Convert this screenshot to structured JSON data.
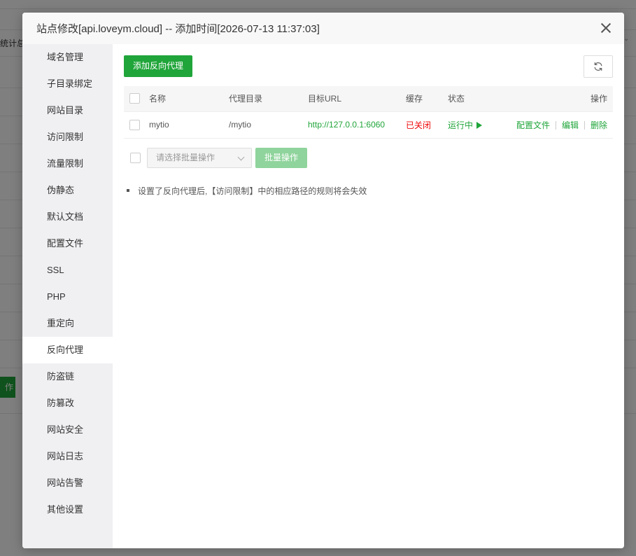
{
  "background": {
    "left_text": "统计总",
    "button_label": "作"
  },
  "modal": {
    "title": "站点修改[api.loveym.cloud] -- 添加时间[2026-07-13 11:37:03]"
  },
  "sidebar": {
    "items": [
      {
        "label": "域名管理"
      },
      {
        "label": "子目录绑定"
      },
      {
        "label": "网站目录"
      },
      {
        "label": "访问限制"
      },
      {
        "label": "流量限制"
      },
      {
        "label": "伪静态"
      },
      {
        "label": "默认文档"
      },
      {
        "label": "配置文件"
      },
      {
        "label": "SSL"
      },
      {
        "label": "PHP"
      },
      {
        "label": "重定向"
      },
      {
        "label": "反向代理"
      },
      {
        "label": "防盗链"
      },
      {
        "label": "防篡改"
      },
      {
        "label": "网站安全"
      },
      {
        "label": "网站日志"
      },
      {
        "label": "网站告警"
      },
      {
        "label": "其他设置"
      }
    ],
    "active_index": 11
  },
  "toolbar": {
    "add_label": "添加反向代理",
    "refresh_icon": "refresh-icon"
  },
  "table": {
    "headers": {
      "name": "名称",
      "dir": "代理目录",
      "url": "目标URL",
      "cache": "缓存",
      "status": "状态",
      "ops": "操作"
    },
    "rows": [
      {
        "name": "mytio",
        "dir": "/mytio",
        "url": "http://127.0.0.1:6060",
        "cache": "已关闭",
        "status": "运行中",
        "op_config": "配置文件",
        "op_edit": "编辑",
        "op_delete": "删除"
      }
    ]
  },
  "batch": {
    "placeholder": "请选择批量操作",
    "button": "批量操作"
  },
  "tips": [
    "设置了反向代理后,【访问限制】中的相应路径的规则将会失效"
  ],
  "colors": {
    "accent": "#20a53a",
    "danger": "#ef0808",
    "sidebar_bg": "#f0f0f3"
  }
}
